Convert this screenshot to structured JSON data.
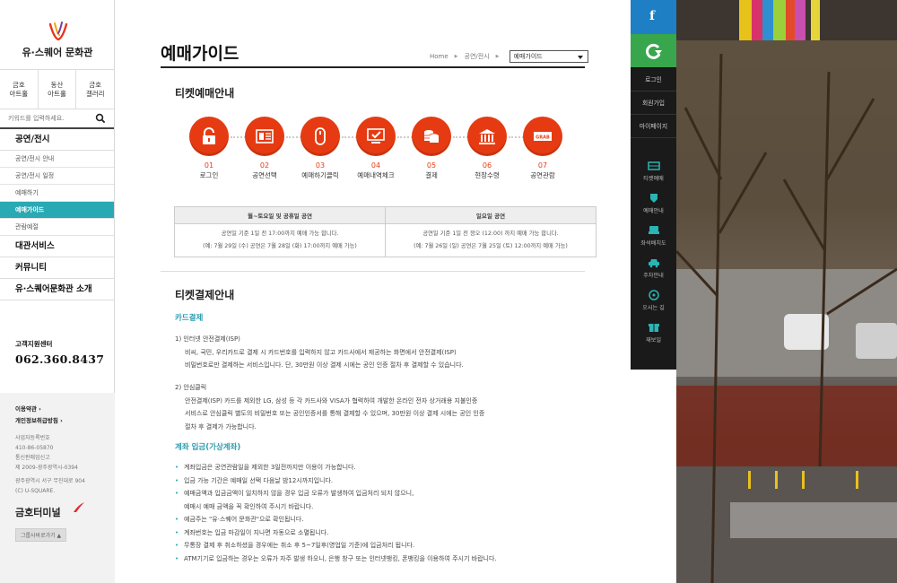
{
  "brand": {
    "name": "유·스퀘어 문화관"
  },
  "halls": [
    "금호\n아트홀",
    "동산\n아트홀",
    "금호\n갤러리"
  ],
  "search": {
    "placeholder": "키워드를 입력하세요."
  },
  "menu": [
    {
      "label": "공연/전시",
      "level": 1
    },
    {
      "label": "공연/전시 안내",
      "level": 2
    },
    {
      "label": "공연/전시 일정",
      "level": 2
    },
    {
      "label": "예매하기",
      "level": 2
    },
    {
      "label": "예매가이드",
      "level": 2,
      "active": true
    },
    {
      "label": "관람예절",
      "level": 2
    },
    {
      "label": "대관서비스",
      "level": 1
    },
    {
      "label": "커뮤니티",
      "level": 1
    },
    {
      "label": "유·스퀘어문화관 소개",
      "level": 1
    }
  ],
  "contact": {
    "label": "고객지원센터",
    "phone": "062.360.8437"
  },
  "footer": {
    "terms": "이용약관 ›",
    "privacy": "개인정보취급방침 ›",
    "biz_label": "사업자등록번호",
    "biz_no": "410-86-05870",
    "comm_label": "통신판매업신고",
    "comm_no": "제 2009-광주광역시-0394",
    "address": "광주광역시 서구 무진대로 904",
    "copyright": "(C) U-SQUARE.",
    "kumho": "금호터미널",
    "family": "그룹사바로가기 ▲"
  },
  "page": {
    "title": "예매가이드"
  },
  "breadcrumb": {
    "home": "Home",
    "section": "공연/전시",
    "current": "예매가이드"
  },
  "booking": {
    "heading": "티켓예매안내",
    "steps": [
      {
        "num": "01",
        "label": "로그인",
        "icon": "lock-icon"
      },
      {
        "num": "02",
        "label": "공연선택",
        "icon": "list-icon"
      },
      {
        "num": "03",
        "label": "예매하기클릭",
        "icon": "mouse-icon"
      },
      {
        "num": "04",
        "label": "예매내역체크",
        "icon": "monitor-check-icon"
      },
      {
        "num": "05",
        "label": "결제",
        "icon": "coins-icon"
      },
      {
        "num": "06",
        "label": "현장수령",
        "icon": "bank-icon"
      },
      {
        "num": "07",
        "label": "공연관람",
        "icon": "ticket-icon"
      }
    ],
    "table": {
      "headers": [
        "월~토요일 및 공휴일 공연",
        "일요일 공연"
      ],
      "rows": [
        [
          "공연일 기준 1일 전 17:00까지 예매 가능 합니다.",
          "공연일 기준 1일 전 정오 (12:00) 까지 예매 가능 합니다."
        ],
        [
          "(예: 7월 29일 (수) 공연은 7월 28일 (화) 17:00까지 예매 가능)",
          "(예: 7월 26일 (일) 공연은 7월 25일 (토) 12:00까지 예매 가능)"
        ]
      ]
    }
  },
  "payment": {
    "heading": "티켓결제안내",
    "card_heading": "카드결제",
    "card_items": [
      {
        "title": "1) 인터넷 안전결제(ISP)",
        "lines": [
          "비씨, 국민, 우리카드로 결제 시 카드번호를 입력하지 않고 카드사에서 제공하는 화면에서 안전결제(ISP)",
          "비밀번호로만 결제하는 서비스입니다. 단, 30만원 이상 결제 시에는 공인 인증 절차 후 결제할 수 있습니다."
        ]
      },
      {
        "title": "2) 안심클릭",
        "lines": [
          "안전결제(ISP) 카드를 제외한 LG, 삼성 등 각 카드사와 VISA가 협력하여 개발한 온라인 전자 상거래용 지불인증",
          "서비스로 안심클릭 별도의 비밀번호 또는 공인인증서를 통해 결제할 수 있으며, 30만원 이상 결제 시에는 공인 인증",
          "절차 후 결제가 가능합니다."
        ]
      }
    ],
    "account_heading": "계좌 입금(가상계좌)",
    "account_items": [
      [
        "계좌입금은 공연관람일을 제외한 3일전까지만 이용이 가능합니다."
      ],
      [
        "입금 가능 기간은 예매일 선택 다음날 밤12시까지입니다."
      ],
      [
        "예매금액과 입금금액이 일치하지 않을 경우 입금 오류가 발생하여 입금처리 되지 않으니,",
        "예매시 예매 금액을 꼭 확인하여 주시기 바랍니다."
      ],
      [
        "예금주는 \"유·스퀘어 문화관\"으로 확인됩니다."
      ],
      [
        "계좌번호는 입금 마감일이 지나면 자동으로 소멸됩니다."
      ],
      [
        "무통장 결제 후 취소하셨을 경우에는 취소 후 5~7일후(영업일 기준)에 입금처리 됩니다."
      ],
      [
        "ATM기기로 입금하는 경우는 오류가 자주 발생 하오니, 은행 창구 또는 인터넷뱅킹, 폰뱅킹을 이용하여 주시기 바랍니다."
      ]
    ]
  },
  "right_panel": {
    "facebook": "f",
    "links": [
      "로그인",
      "회원가입",
      "마이페이지"
    ],
    "items": [
      {
        "label": "티켓예매",
        "icon": "ticket-icon"
      },
      {
        "label": "예매안내",
        "icon": "shield-icon"
      },
      {
        "label": "좌석배치도",
        "icon": "seat-icon"
      },
      {
        "label": "주차안내",
        "icon": "car-icon"
      },
      {
        "label": "오시는 길",
        "icon": "compass-icon"
      },
      {
        "label": "재보일",
        "icon": "gift-icon"
      }
    ]
  }
}
